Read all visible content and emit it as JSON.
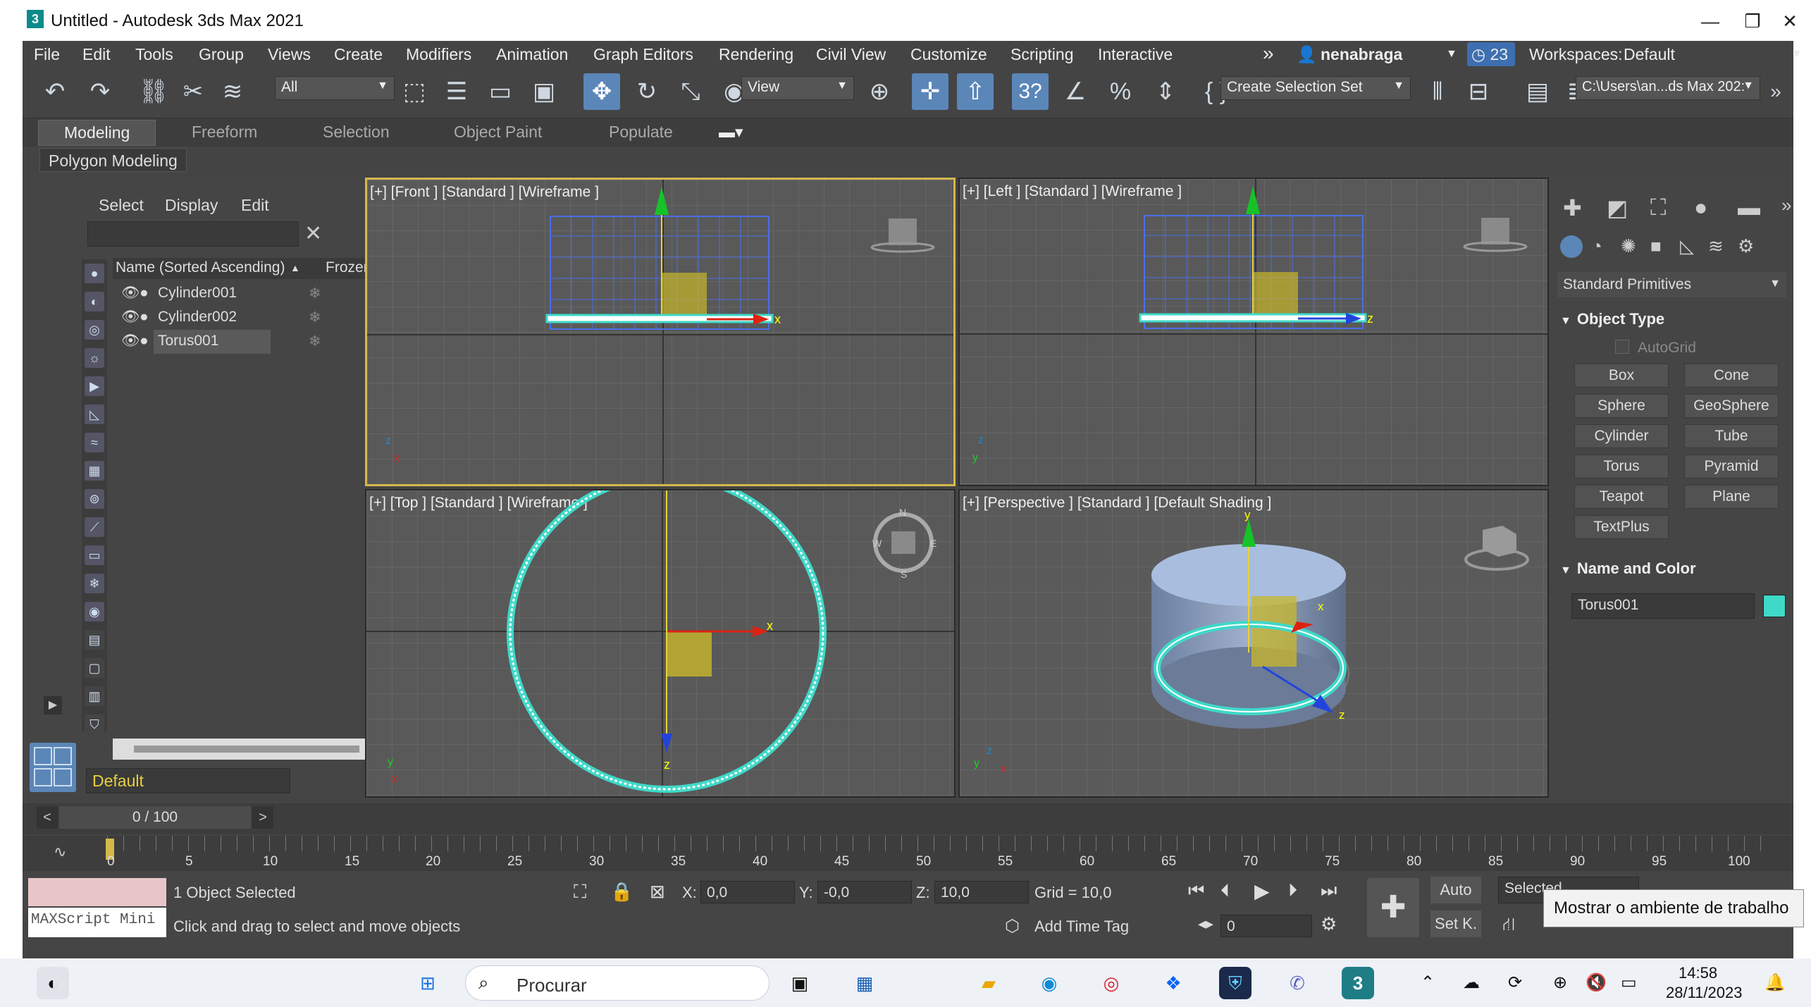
{
  "window": {
    "title": "Untitled - Autodesk 3ds Max 2021",
    "logo": "3",
    "minimize": "—",
    "maximize": "❐",
    "close": "✕"
  },
  "menu": [
    "File",
    "Edit",
    "Tools",
    "Group",
    "Views",
    "Create",
    "Modifiers",
    "Animation",
    "Graph Editors",
    "Rendering",
    "Civil View",
    "Customize",
    "Scripting",
    "Interactive"
  ],
  "menu_more": "»",
  "account": {
    "user": "nenabraga",
    "badge": "23",
    "workspaces_label": "Workspaces:",
    "workspace": "Default"
  },
  "toolbar": {
    "selection_filter": "All",
    "ref_coord": "View",
    "selection_set": "Create Selection Set",
    "project_path": "C:\\Users\\an...ds Max 202:"
  },
  "ribbon": {
    "tabs": [
      "Modeling",
      "Freeform",
      "Selection",
      "Object Paint",
      "Populate"
    ],
    "active": "Polygon Modeling"
  },
  "scene_explorer": {
    "tabs": [
      "Select",
      "Display",
      "Edit"
    ],
    "col_name": "Name (Sorted Ascending)",
    "sort_arrow": "▲",
    "col_frozen": "Frozen",
    "objects": [
      "Cylinder001",
      "Cylinder002",
      "Torus001"
    ],
    "layer": "Default"
  },
  "viewports": {
    "front": "[+] [Front ] [Standard ] [Wireframe ]",
    "left": "[+] [Left ] [Standard ] [Wireframe ]",
    "top": "[+] [Top ] [Standard ] [Wireframe ]",
    "perspective": "[+] [Perspective ] [Standard ] [Default Shading ]"
  },
  "command_panel": {
    "dropdown": "Standard Primitives",
    "object_type": "Object Type",
    "autogrid": "AutoGrid",
    "buttons": [
      "Box",
      "Cone",
      "Sphere",
      "GeoSphere",
      "Cylinder",
      "Tube",
      "Torus",
      "Pyramid",
      "Teapot",
      "Plane",
      "TextPlus"
    ],
    "name_and_color": "Name and Color",
    "object_name": "Torus001",
    "object_color": "#3fd9c8"
  },
  "time": {
    "frame_display": "0 / 100",
    "ticks": [
      "0",
      "5",
      "10",
      "15",
      "20",
      "25",
      "30",
      "35",
      "40",
      "45",
      "50",
      "55",
      "60",
      "65",
      "70",
      "75",
      "80",
      "85",
      "90",
      "95",
      "100"
    ]
  },
  "status": {
    "maxscript": "MAXScript Mini",
    "selected": "1 Object Selected",
    "prompt": "Click and drag to select and move objects",
    "x_label": "X:",
    "x": "0,0",
    "y_label": "Y:",
    "y": "-0,0",
    "z_label": "Z:",
    "z": "10,0",
    "grid": "Grid = 10,0",
    "add_time_tag": "Add Time Tag",
    "auto": "Auto",
    "set_k": "Set K.",
    "selected_dd": "Selected",
    "frame": "0"
  },
  "tooltip": "Mostrar o ambiente de trabalho",
  "taskbar": {
    "search": "Procurar",
    "time": "14:58",
    "date": "28/11/2023"
  },
  "colors": {
    "accent": "#5b86b8",
    "active_border": "#d4b84a",
    "torus": "#3fd9c8"
  }
}
